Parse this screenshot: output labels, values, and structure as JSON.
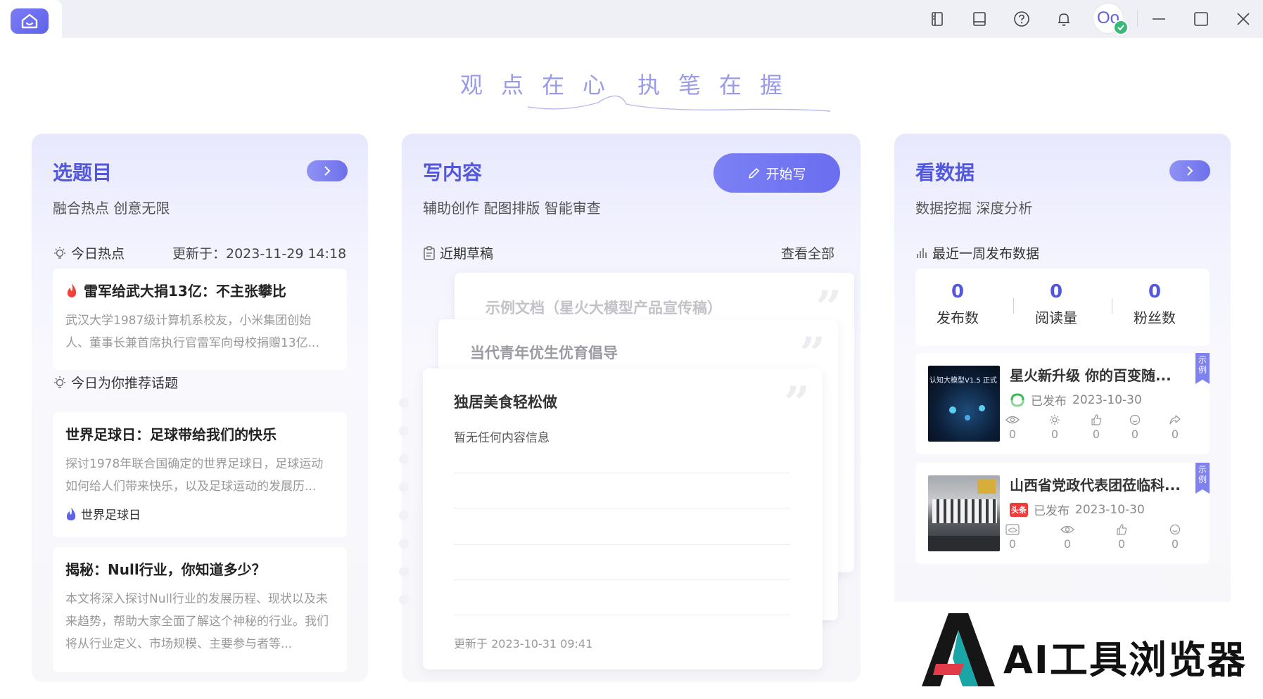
{
  "slogan": [
    "观",
    "点",
    "在",
    "心",
    "执",
    "笔",
    "在",
    "握"
  ],
  "topbar": {
    "avatar_text": "Oo",
    "icons": [
      "sidebar-icon",
      "book-icon",
      "help-icon",
      "bell-icon",
      "minimize-icon",
      "maximize-icon",
      "close-icon"
    ]
  },
  "topic_card": {
    "title": "选题目",
    "subtitle": "融合热点 创意无限",
    "hot_label": "今日热点",
    "updated": "更新于：2023-11-29 14:18",
    "hot_news": {
      "title": "雷军给武大捐13亿：不主张攀比",
      "desc": "武汉大学1987级计算机系校友，小米集团创始人、董事长兼首席执行官雷军向母校捐赠13亿..."
    },
    "recommend_label": "今日为你推荐话题",
    "recommendations": [
      {
        "title": "世界足球日：足球带给我们的快乐",
        "desc": "探讨1978年联合国确定的世界足球日，足球运动如何给人们带来快乐，以及足球运动的发展历...",
        "tag": "世界足球日"
      },
      {
        "title": "揭秘：Null行业，你知道多少？",
        "desc": "本文将深入探讨Null行业的发展历程、现状以及未来趋势，帮助大家全面了解这个神秘的行业。我们将从行业定义、市场规模、主要参与者等..."
      }
    ]
  },
  "write_card": {
    "title": "写内容",
    "subtitle": "辅助创作 配图排版 智能审查",
    "start_button": "开始写",
    "drafts_label": "近期草稿",
    "view_all": "查看全部",
    "drafts": [
      {
        "title": "示例文档（星火大模型产品宣传稿）"
      },
      {
        "title": "当代青年优生优育倡导"
      },
      {
        "title": "独居美食轻松做",
        "body": "暂无任何内容信息",
        "updated": "更新于 2023-10-31 09:41"
      }
    ]
  },
  "data_card": {
    "title": "看数据",
    "subtitle": "数据挖掘 深度分析",
    "week_label": "最近一周发布数据",
    "stats": [
      {
        "value": "0",
        "label": "发布数"
      },
      {
        "value": "0",
        "label": "阅读量"
      },
      {
        "value": "0",
        "label": "粉丝数"
      }
    ],
    "articles": [
      {
        "title": "星火新升级 你的百变随...",
        "status": "已发布",
        "date": "2023-10-30",
        "platform_icon": "wechat-channel-icon",
        "thumb_text": "认知大模型V1.5 正式",
        "flag": "示例",
        "metrics": [
          "0",
          "0",
          "0",
          "0",
          "0"
        ]
      },
      {
        "title": "山西省党政代表团莅临科...",
        "status": "已发布",
        "date": "2023-10-30",
        "platform_icon": "toutiao-icon",
        "platform_badge": "头条",
        "flag": "示例",
        "metrics": [
          "0",
          "0",
          "0",
          "0"
        ]
      }
    ]
  },
  "watermark": {
    "text": "AI工具浏览器"
  },
  "colors": {
    "accent": "#5357d9",
    "accent_light": "#7c80f4",
    "top_bar": "#eef0f6"
  }
}
